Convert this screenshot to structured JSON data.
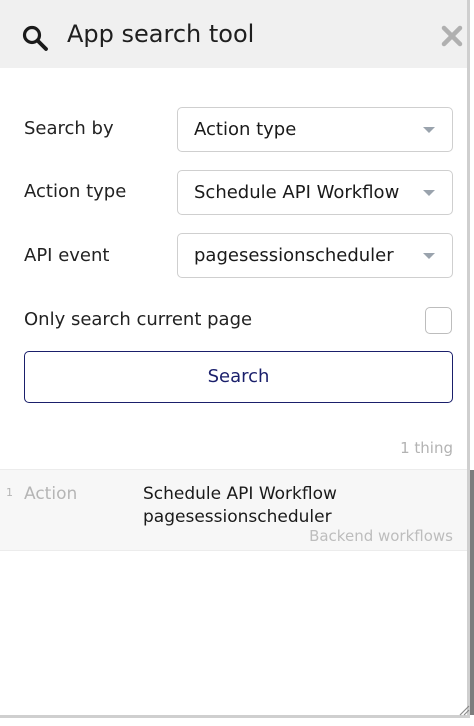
{
  "header": {
    "title": "App search tool",
    "search_icon": "search-icon",
    "close_icon": "close-icon"
  },
  "form": {
    "search_by": {
      "label": "Search by",
      "value": "Action type"
    },
    "action_type": {
      "label": "Action type",
      "value": "Schedule API Workflow"
    },
    "api_event": {
      "label": "API event",
      "value": "pagesessionscheduler"
    },
    "only_current_page": {
      "label": "Only search current page",
      "checked": false
    },
    "search_button": "Search"
  },
  "results": {
    "count": "1 thing",
    "items": [
      {
        "index": "1",
        "type": "Action",
        "line1": "Schedule API Workflow",
        "line2": "pagesessionscheduler",
        "context": "Backend workflows"
      }
    ]
  },
  "colors": {
    "header_bg": "#f0f0f0",
    "accent": "#1a1f6b",
    "muted": "#b3b3b3"
  }
}
